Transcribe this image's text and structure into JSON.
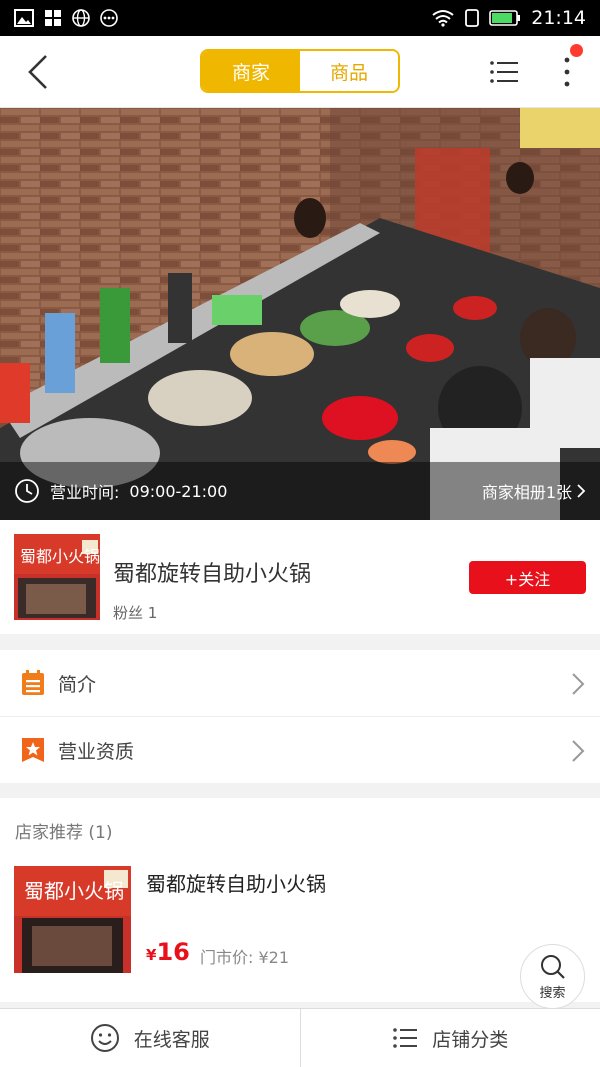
{
  "status_bar": {
    "time": "21:14"
  },
  "nav": {
    "tabs": [
      {
        "label": "商家",
        "active": true
      },
      {
        "label": "商品",
        "active": false
      }
    ],
    "accent": "#f0b700"
  },
  "hero": {
    "hours_label": "营业时间:",
    "hours": "09:00-21:00",
    "album": "商家相册1张"
  },
  "merchant": {
    "name": "蜀都旋转自助小火锅",
    "fans": "粉丝 1",
    "follow_label": "+关注",
    "follow_color": "#e8101a",
    "sign_text": "蜀都小火锅"
  },
  "menu": [
    {
      "label": "简介",
      "icon": "list-icon"
    },
    {
      "label": "营业资质",
      "icon": "star-badge-icon"
    }
  ],
  "recommend": {
    "title": "店家推荐 (1)",
    "item": {
      "name": "蜀都旋转自助小火锅",
      "price_symbol": "¥",
      "price": "16",
      "original": "门市价: ¥21"
    }
  },
  "search_fab": {
    "label": "搜索"
  },
  "bottom_bar": [
    {
      "label": "在线客服",
      "icon": "smiley-icon"
    },
    {
      "label": "店铺分类",
      "icon": "list-icon"
    }
  ]
}
